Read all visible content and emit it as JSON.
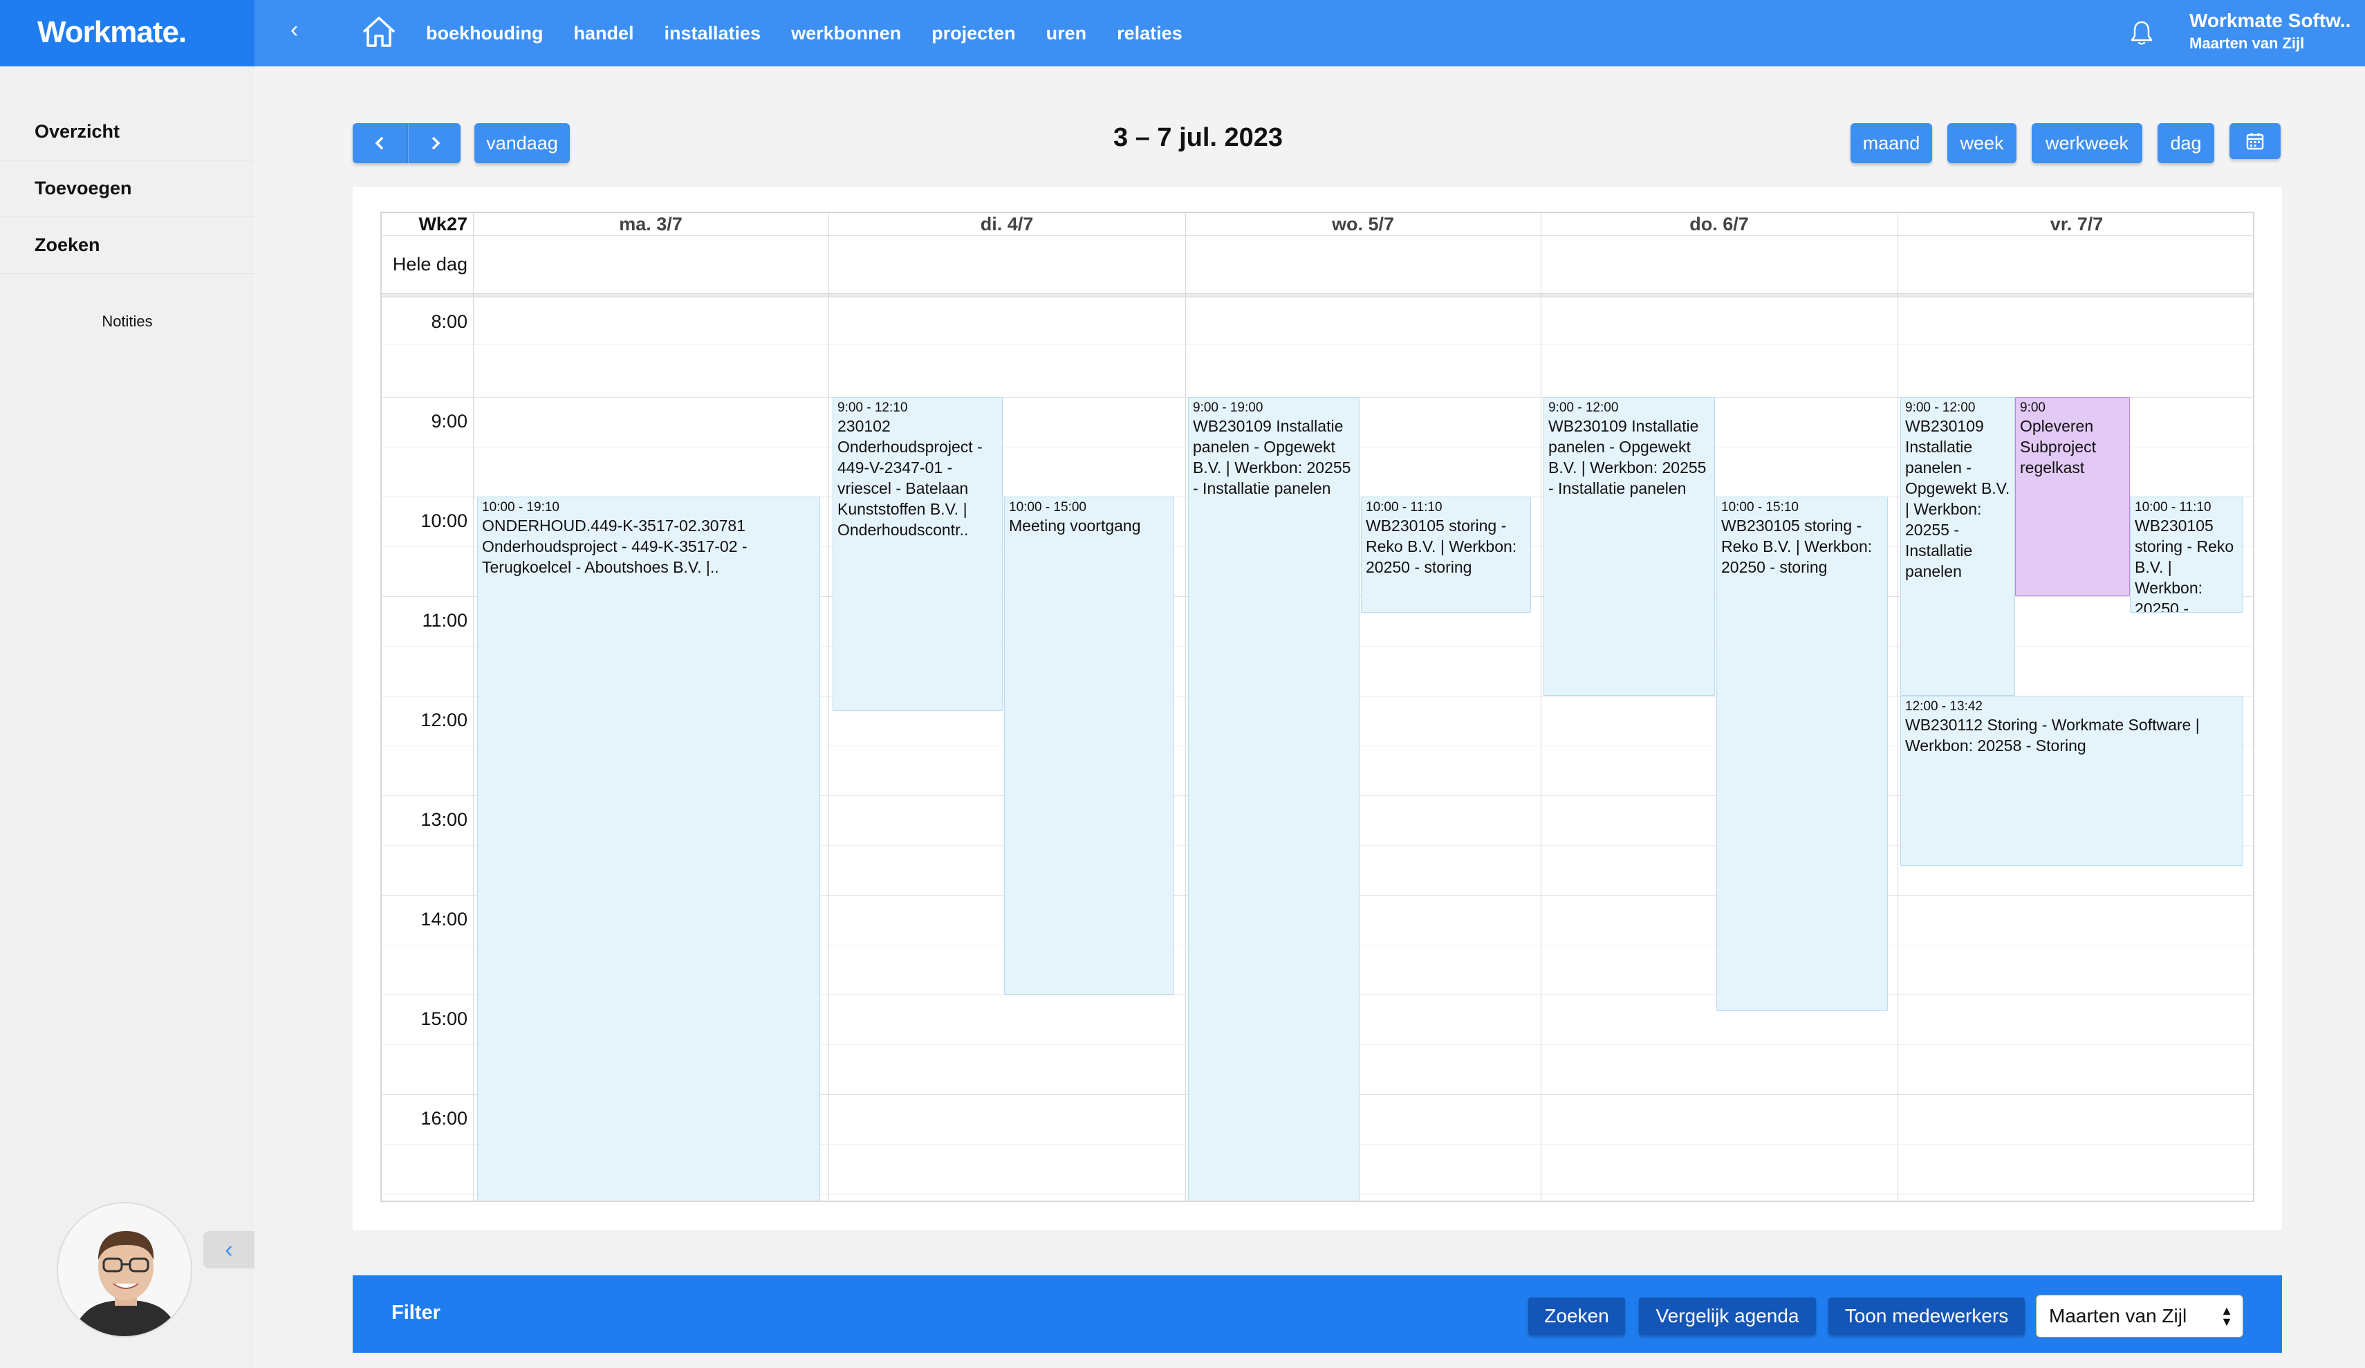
{
  "app": {
    "logo": "Workmate.",
    "collapse_icon": "chevron-left-icon",
    "nav": [
      "boekhouding",
      "handel",
      "installaties",
      "werkbonnen",
      "projecten",
      "uren",
      "relaties"
    ],
    "company": "Workmate Softw..",
    "user": "Maarten van Zijl"
  },
  "sidebar": {
    "items": [
      "Overzicht",
      "Toevoegen",
      "Zoeken"
    ],
    "notes": "Notities",
    "toggle_icon": "chevron-left-icon"
  },
  "toolbar": {
    "prev_icon": "chevron-left-icon",
    "next_icon": "chevron-right-icon",
    "today": "vandaag",
    "title": "3 – 7 jul. 2023",
    "views": [
      "maand",
      "week",
      "werkweek",
      "dag"
    ],
    "calendar_icon": "calendar-icon"
  },
  "calendar": {
    "week": "Wk27",
    "all_day": "Hele dag",
    "days": [
      "ma. 3/7",
      "di. 4/7",
      "wo. 5/7",
      "do. 6/7",
      "vr. 7/7"
    ],
    "hours": [
      "8:00",
      "9:00",
      "10:00",
      "11:00",
      "12:00",
      "13:00",
      "14:00",
      "15:00",
      "16:00"
    ],
    "events": [
      {
        "time": "10:00 - 19:10",
        "title": "ONDERHOUD.449-K-3517-02.30781 Onderhoudsproject - 449-K-3517-02 - Terugkoelcel - Aboutshoes B.V. |.."
      },
      {
        "time": "9:00 - 12:10",
        "title": "230102 Onderhoudsproject - 449-V-2347-01 - vriescel - Batelaan Kunststoffen B.V. | Onderhoudscontr.."
      },
      {
        "time": "10:00 - 15:00",
        "title": "Meeting voortgang"
      },
      {
        "time": "9:00 - 19:00",
        "title": "WB230109 Installatie panelen - Opgewekt B.V. | Werkbon: 20255 - Installatie panelen"
      },
      {
        "time": "10:00 - 11:10",
        "title": "WB230105 storing - Reko B.V. | Werkbon: 20250 - storing"
      },
      {
        "time": "9:00 - 12:00",
        "title": "WB230109 Installatie panelen - Opgewekt B.V. | Werkbon: 20255 - Installatie panelen"
      },
      {
        "time": "10:00 - 15:10",
        "title": "WB230105 storing - Reko B.V. | Werkbon: 20250 - storing"
      },
      {
        "time": "9:00 - 12:00",
        "title": "WB230109 Installatie panelen - Opgewekt B.V. | Werkbon: 20255 - Installatie panelen"
      },
      {
        "time": "9:00",
        "title": "Opleveren Subproject regelkast"
      },
      {
        "time": "10:00 - 11:10",
        "title": "WB230105 storing - Reko B.V. | Werkbon: 20250 -"
      },
      {
        "time": "12:00 - 13:42",
        "title": "WB230112 Storing - Workmate Software | Werkbon: 20258 - Storing"
      }
    ]
  },
  "filter": {
    "label": "Filter",
    "search": "Zoeken",
    "compare": "Vergelijk agenda",
    "employees": "Toon medewerkers",
    "employee_select": "Maarten van Zijl"
  },
  "colors": {
    "brand": "#1f7df0",
    "topbar": "#3d8ff2",
    "event": "#e5f3fb",
    "event_purple": "#e3c9f6",
    "filter_button": "#1356b8"
  }
}
